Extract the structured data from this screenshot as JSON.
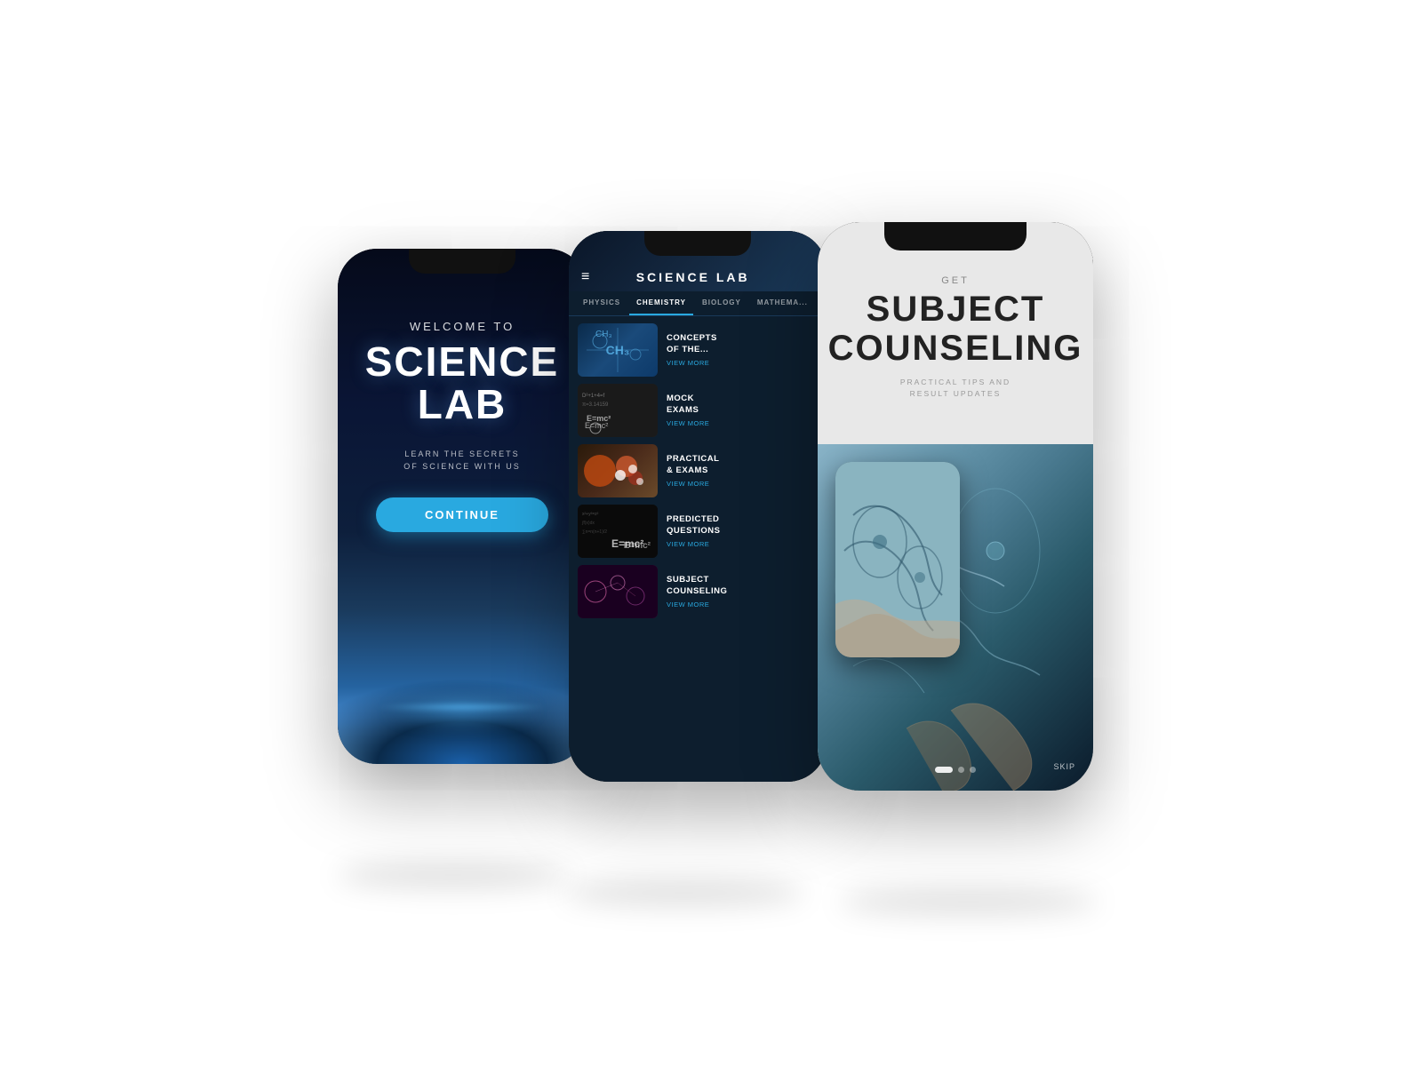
{
  "page": {
    "background": "#ffffff"
  },
  "phone1": {
    "welcome_label": "WELCOME TO",
    "title_line1": "SCIENCE",
    "title_line2": "LAB",
    "tagline_line1": "LEARN THE SECRETS",
    "tagline_line2": "OF SCIENCE WITH US",
    "continue_button": "CONTINUE"
  },
  "phone2": {
    "header_title": "SCIENCE LAB",
    "menu_icon": "≡",
    "tabs": [
      {
        "label": "PHYSICS",
        "active": false
      },
      {
        "label": "CHEMISTRY",
        "active": true
      },
      {
        "label": "BIOLOGY",
        "active": false
      },
      {
        "label": "MATHEMA...",
        "active": false
      }
    ],
    "list_items": [
      {
        "title": "CONCEPTS OF THE...",
        "view_more": "VIEW MORE"
      },
      {
        "title": "MOCK EXAMS",
        "view_more": "VIEW MORE"
      },
      {
        "title": "PRACTICAL & EXAMS",
        "view_more": "VIEW MORE"
      },
      {
        "title": "PREDICTED QUESTIONS",
        "view_more": "VIEW MORE"
      },
      {
        "title": "SUBJECT COUNSELING",
        "view_more": "VIEW MORE"
      }
    ]
  },
  "phone3": {
    "get_label": "GET",
    "title_line1": "SUBJECT",
    "title_line2": "COUNSELING",
    "subtitle_line1": "PRACTICAL TIPS AND",
    "subtitle_line2": "RESULT UPDATES",
    "skip_label": "SKIP",
    "dots": [
      {
        "active": true
      },
      {
        "active": false
      },
      {
        "active": false
      }
    ]
  }
}
